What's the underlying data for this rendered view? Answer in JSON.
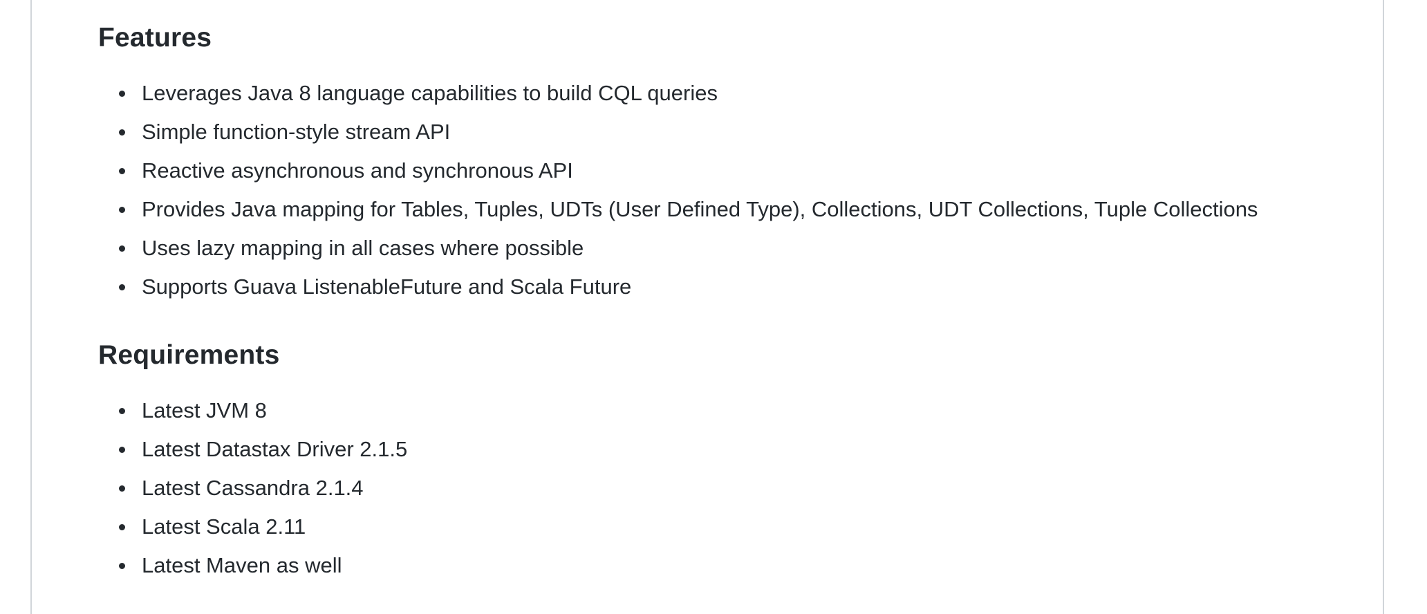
{
  "features": {
    "heading": "Features",
    "items": [
      "Leverages Java 8 language capabilities to build CQL queries",
      "Simple function-style stream API",
      "Reactive asynchronous and synchronous API",
      "Provides Java mapping for Tables, Tuples, UDTs (User Defined Type), Collections, UDT Collections, Tuple Collections",
      "Uses lazy mapping in all cases where possible",
      "Supports Guava ListenableFuture and Scala Future"
    ]
  },
  "requirements": {
    "heading": "Requirements",
    "items": [
      "Latest JVM 8",
      "Latest Datastax Driver 2.1.5",
      "Latest Cassandra 2.1.4",
      "Latest Scala 2.11",
      "Latest Maven as well"
    ]
  },
  "icons": {
    "bullet": "bullet-dot-icon"
  }
}
